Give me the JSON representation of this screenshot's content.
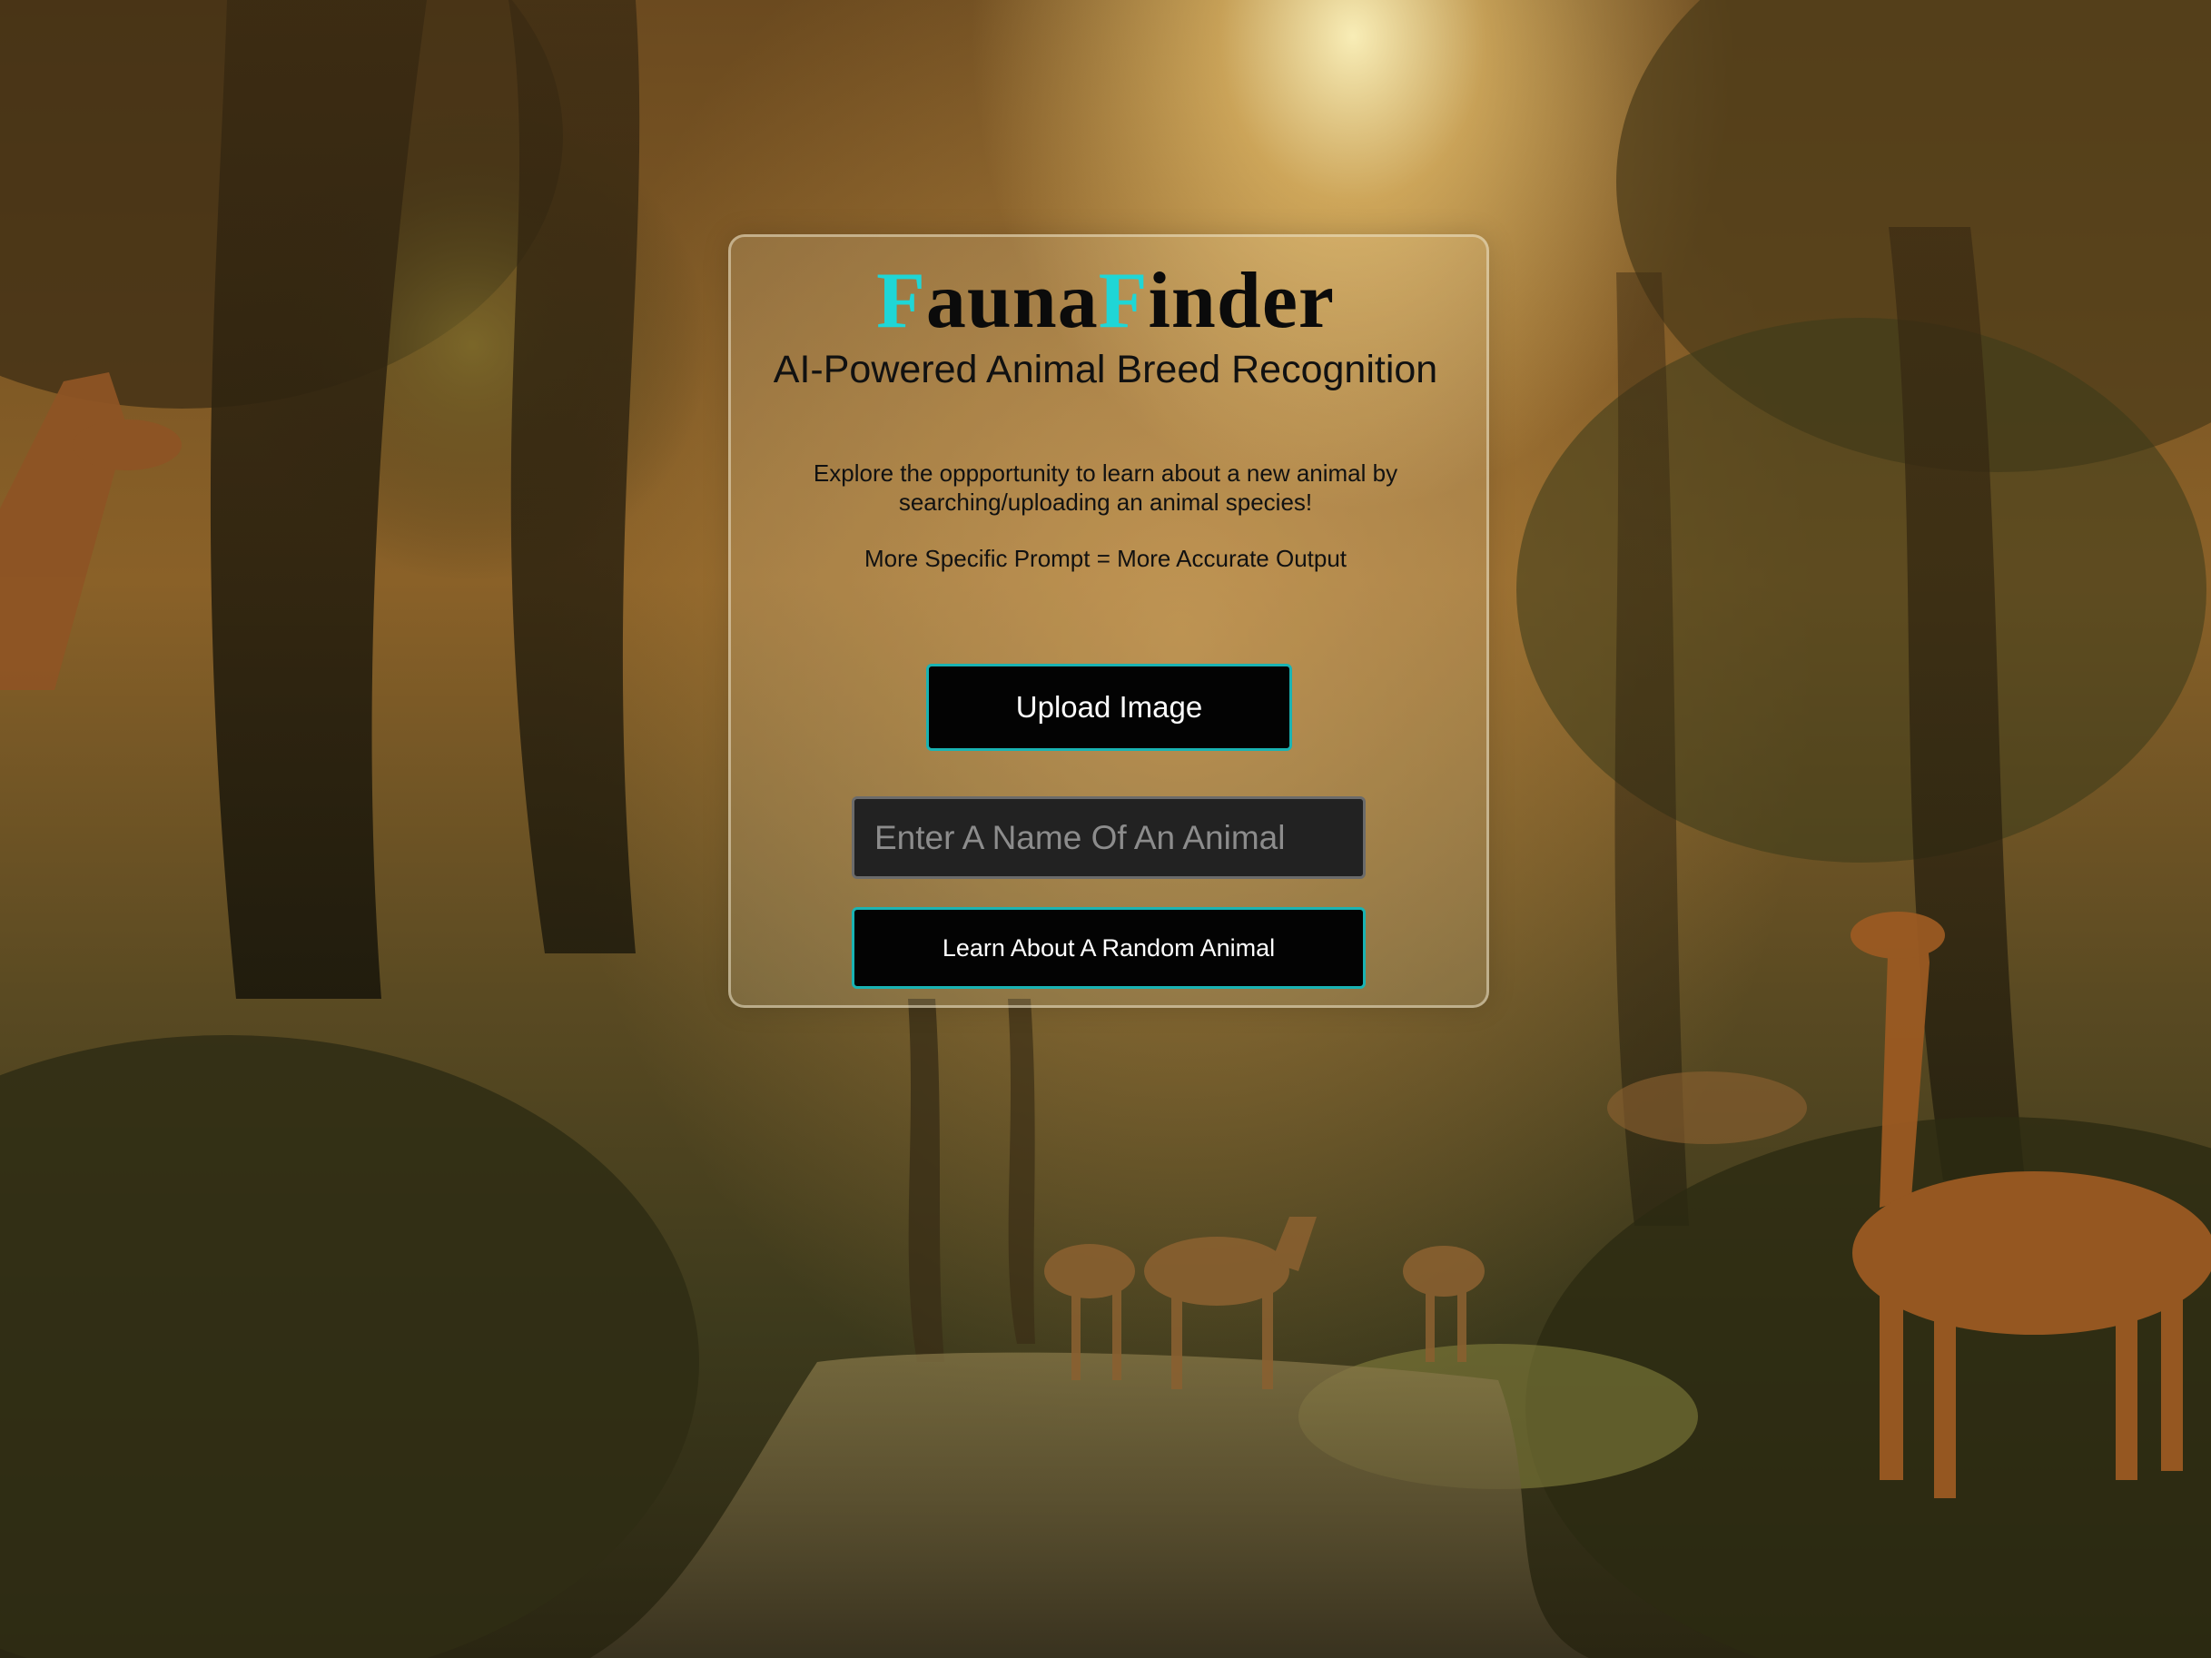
{
  "app": {
    "title_letter_1": "F",
    "title_part_1": "auna",
    "title_letter_2": "F",
    "title_part_2": "inder",
    "subtitle": "AI-Powered Animal Breed Recognition",
    "description": "Explore the oppportunity to learn about a new animal by searching/uploading an animal species!",
    "hint": "More Specific Prompt = More Accurate Output",
    "upload_label": "Upload Image",
    "search_placeholder": "Enter A Name Of An Animal",
    "search_value": "",
    "random_label": "Learn About A Random Animal"
  },
  "colors": {
    "accent": "#1fd6d6",
    "button_bg": "#030303",
    "button_border": "#1ab3b3",
    "input_bg": "#222222"
  },
  "background": {
    "subject": "jungle-forest-with-giraffes"
  }
}
